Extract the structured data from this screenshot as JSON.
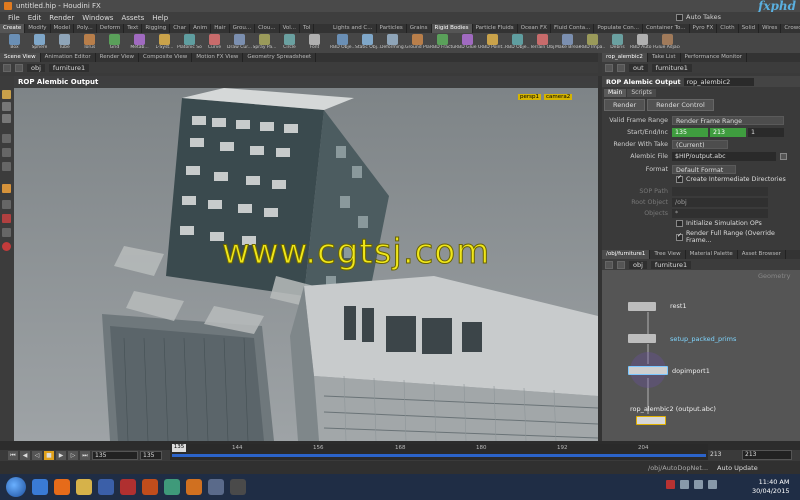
{
  "window": {
    "title": "untitled.hip - Houdini FX",
    "brand": "fxphd"
  },
  "menu": [
    "File",
    "Edit",
    "Render",
    "Windows",
    "Assets",
    "Help"
  ],
  "auto_takes": "Auto Takes",
  "shelf_tabs_left": [
    "Create",
    "Modify",
    "Model",
    "Poly...",
    "Deform",
    "Text",
    "Rigging",
    "Char",
    "Anim",
    "Hair",
    "Grou...",
    "Clou...",
    "Vol...",
    "Tol"
  ],
  "shelf_tabs_right": [
    "Lights and C...",
    "Particles",
    "Grains",
    "Rigid Bodies",
    "Particle Fluids",
    "Ocean FX",
    "Fluid Conta...",
    "Populate Con...",
    "Container To...",
    "Pyro FX",
    "Cloth",
    "Solid",
    "Wires",
    "Crowds",
    "Drive Simul..."
  ],
  "shelf_tools_left": [
    "Box",
    "Sphere",
    "Tube",
    "Torus",
    "Grid",
    "Metab...",
    "L-Syst...",
    "Platonic Sol...",
    "Curve",
    "Draw Cur...",
    "Spray Pa...",
    "Circle",
    "Font"
  ],
  "shelf_tools_right": [
    "RBD Obje...",
    "Static Obj...",
    "Deforming...",
    "Ground Pla...",
    "RBD Fractur...",
    "RBD Glue O...",
    "RBD Point...",
    "RBD Obje...",
    "Terrain Obj...",
    "Make Break...",
    "RBD Impa...",
    "Debris",
    "RBD Auto F...",
    "Glue Adjace..."
  ],
  "pane_tabs": [
    "Scene View",
    "Animation Editor",
    "Render View",
    "Composite View",
    "Motion FX View",
    "Geometry Spreadsheet"
  ],
  "viewport": {
    "path_root": "obj",
    "path_node": "furniture1",
    "header": "ROP Alembic Output",
    "camera_persp": "persp1",
    "camera_cam": "camera2",
    "watermark": "www.cgtsj.com"
  },
  "param": {
    "tabs": [
      "rop_alembic2",
      "Take List",
      "Performance Monitor"
    ],
    "path_root": "out",
    "path_node": "furniture1",
    "node_type": "ROP Alembic Output",
    "node_name": "rop_alembic2",
    "subtabs": [
      "Main",
      "Scripts"
    ],
    "render_btn": "Render",
    "render_control_btn": "Render Control",
    "rows": {
      "valid_frame_range_label": "Valid Frame Range",
      "valid_frame_range_value": "Render Frame Range",
      "start_end_inc_label": "Start/End/Inc",
      "start": "135",
      "end": "213",
      "inc": "1",
      "render_with_take_label": "Render With Take",
      "render_with_take_value": "(Current)",
      "alembic_file_label": "Alembic File",
      "alembic_file_value": "$HIP/output.abc",
      "format_label": "Format",
      "format_value": "Default Format",
      "create_dirs": "Create Intermediate Directories",
      "sop_path_label": "SOP Path",
      "root_object_label": "Root Object",
      "root_object_value": "/obj",
      "objects_label": "Objects",
      "objects_value": "*",
      "init_sim": "Initialize Simulation OPs",
      "render_full_range": "Render Full Range (Override Frame..."
    }
  },
  "network": {
    "tabs": [
      "/obj/furniture1",
      "Tree View",
      "Material Palette",
      "Asset Browser"
    ],
    "path_root": "obj",
    "path_node": "furniture1",
    "context_label": "Geometry",
    "nodes": [
      "rest1",
      "setup_packed_prims",
      "dopimport1",
      "rop_alembic2 (output.abc)"
    ]
  },
  "timeline": {
    "current_frame": "135",
    "start_field": "135",
    "start_field2": "135",
    "ticks": [
      "144",
      "156",
      "168",
      "180",
      "192",
      "204"
    ],
    "end_frame": "213",
    "end_frame2": "213",
    "status_path": "/obj/AutoDopNet...",
    "auto_update": "Auto Update"
  },
  "taskbar": {
    "time": "11:40 AM",
    "date": "30/04/2015"
  }
}
